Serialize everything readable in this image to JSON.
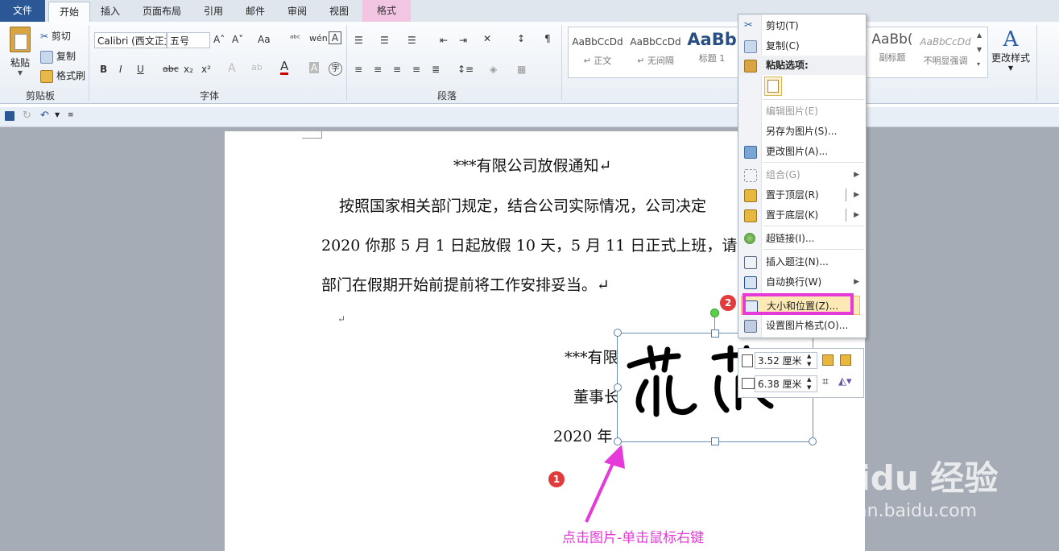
{
  "tabs": {
    "file": "文件",
    "home": "开始",
    "insert": "插入",
    "layout": "页面布局",
    "references": "引用",
    "mailings": "邮件",
    "review": "审阅",
    "view": "视图",
    "format": "格式"
  },
  "clipboard": {
    "paste": "粘贴",
    "cut": "剪切",
    "copy": "复制",
    "format_painter": "格式刷",
    "label": "剪贴板"
  },
  "font": {
    "name": "Calibri (西文正文)",
    "size": "五号",
    "label": "字体",
    "bold": "B",
    "italic": "I",
    "underline": "U",
    "strike": "abc",
    "sub": "x₂",
    "sup": "x²",
    "grow": "A˄",
    "shrink": "A˅",
    "case": "Aa",
    "font_color": "A",
    "highlight": "A"
  },
  "paragraph": {
    "label": "段落"
  },
  "styles": {
    "items": [
      {
        "sample": "AaBbCcDd",
        "name": "↵ 正文"
      },
      {
        "sample": "AaBbCcDd",
        "name": "↵ 无间隔"
      },
      {
        "sample": "AaBb",
        "name": "标题 1"
      },
      {
        "sample": "AaBb(",
        "name": "副标题"
      },
      {
        "sample": "AaBbCcDd",
        "name": "不明显强调"
      }
    ],
    "change_styles": "更改样式"
  },
  "document": {
    "title": "***有限公司放假通知↵",
    "line1": "按照国家相关部门规定，结合公司实际情况，公司决定",
    "line2": "2020 你那 5 月 1 日起放假 10 天，5 月 11 日正式上班，请",
    "line3": "部门在假期开始前提前将工作安排妥当。↵",
    "empty_mark": "↵",
    "sign_company": "***有限",
    "sign_board": "董事长",
    "sign_date": "2020 年"
  },
  "context_menu": {
    "items": [
      {
        "label": "剪切(T)",
        "icon": "scissors-icon",
        "enabled": true
      },
      {
        "label": "复制(C)",
        "icon": "copy-icon",
        "enabled": true
      },
      {
        "label": "粘贴选项:",
        "icon": "paste-icon",
        "enabled": true
      },
      {
        "label": "编辑图片(E)",
        "icon": "",
        "enabled": false
      },
      {
        "label": "另存为图片(S)...",
        "icon": "",
        "enabled": true
      },
      {
        "label": "更改图片(A)...",
        "icon": "change-picture-icon",
        "enabled": true
      },
      {
        "label": "组合(G)",
        "icon": "group-icon",
        "enabled": false
      },
      {
        "label": "置于顶层(R)",
        "icon": "bring-front-icon",
        "enabled": true
      },
      {
        "label": "置于底层(K)",
        "icon": "send-back-icon",
        "enabled": true
      },
      {
        "label": "超链接(I)...",
        "icon": "hyperlink-icon",
        "enabled": true
      },
      {
        "label": "插入题注(N)...",
        "icon": "caption-icon",
        "enabled": true
      },
      {
        "label": "自动换行(W)",
        "icon": "wrap-icon",
        "enabled": true
      },
      {
        "label": "大小和位置(Z)...",
        "icon": "size-position-icon",
        "enabled": true
      },
      {
        "label": "设置图片格式(O)...",
        "icon": "format-picture-icon",
        "enabled": true
      }
    ]
  },
  "mini_toolbar": {
    "height": "3.52 厘米",
    "width": "6.38 厘米"
  },
  "annotation": {
    "badge1": "1",
    "badge2": "2",
    "caption": "点击图片-单击鼠标右键"
  },
  "watermark": {
    "brand": "Baidu 经验",
    "url": "jingyan.baidu.com"
  },
  "colors": {
    "accent_magenta": "#e53ad9",
    "file_tab": "#2b5797",
    "badge_red": "#e23b3b"
  }
}
